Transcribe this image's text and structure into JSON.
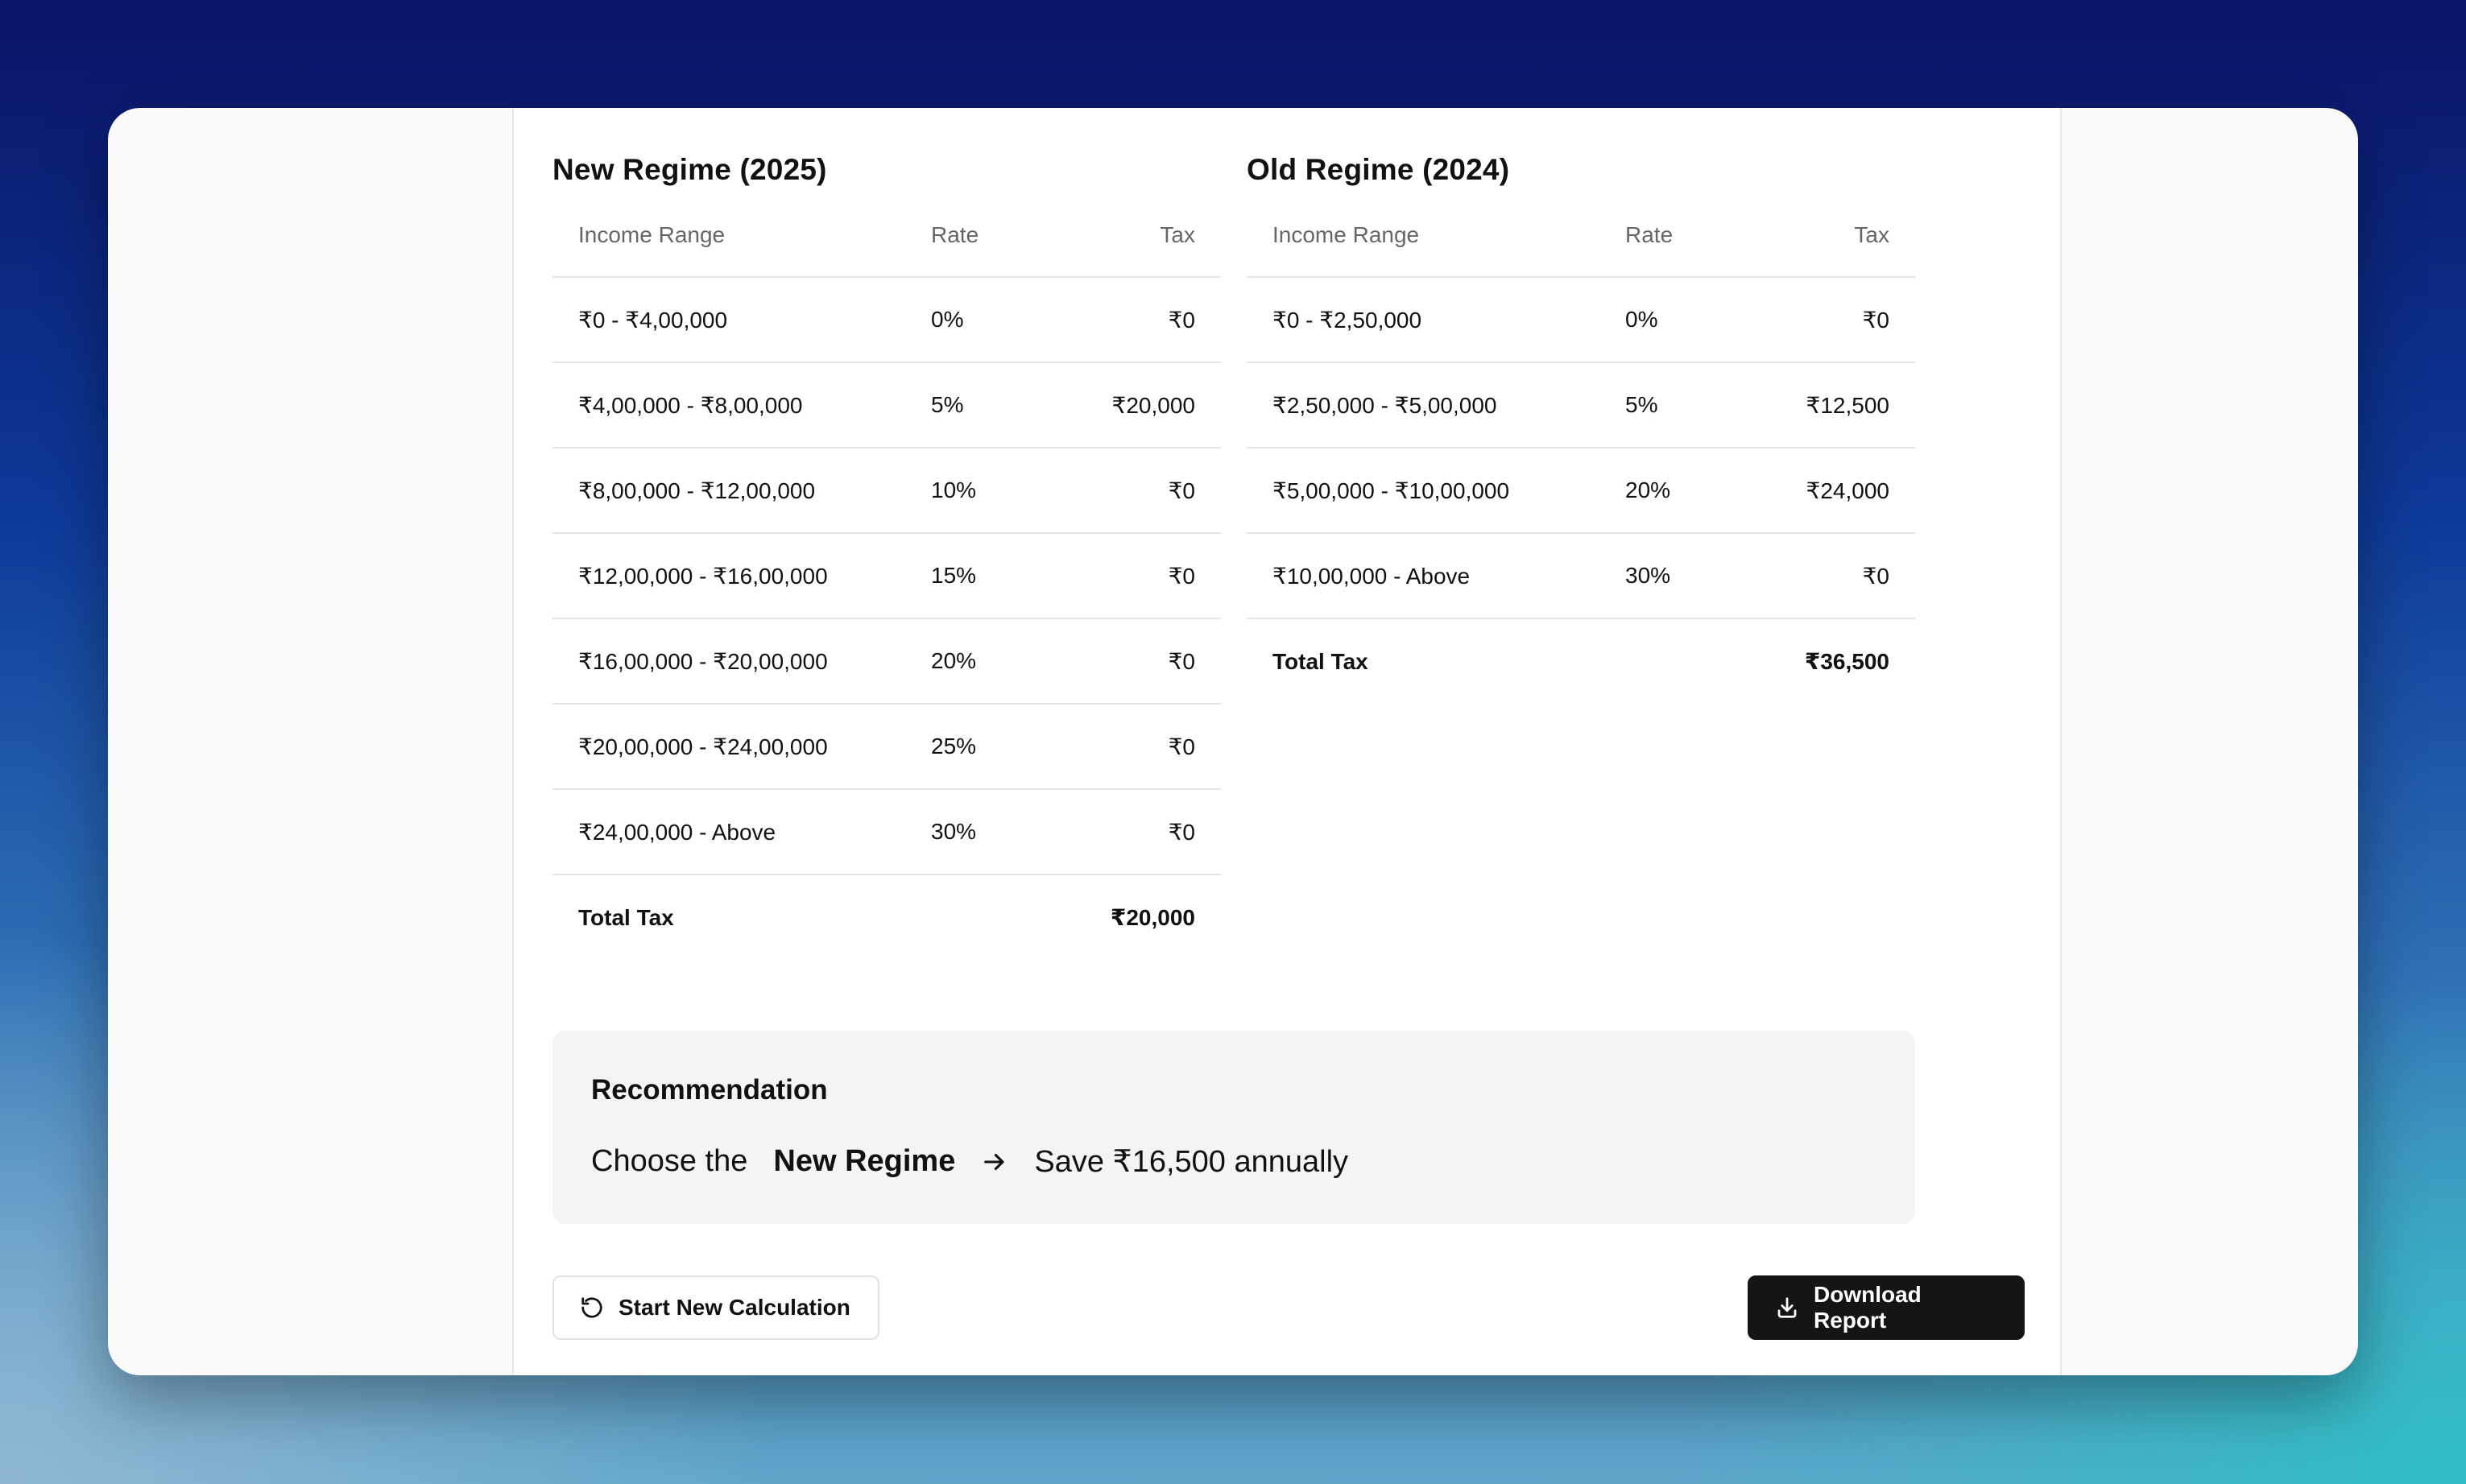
{
  "new_regime": {
    "title": "New Regime (2025)",
    "headers": {
      "range": "Income Range",
      "rate": "Rate",
      "tax": "Tax"
    },
    "rows": [
      {
        "range": "₹0 - ₹4,00,000",
        "rate": "0%",
        "tax": "₹0"
      },
      {
        "range": "₹4,00,000 - ₹8,00,000",
        "rate": "5%",
        "tax": "₹20,000"
      },
      {
        "range": "₹8,00,000 - ₹12,00,000",
        "rate": "10%",
        "tax": "₹0"
      },
      {
        "range": "₹12,00,000 - ₹16,00,000",
        "rate": "15%",
        "tax": "₹0"
      },
      {
        "range": "₹16,00,000 - ₹20,00,000",
        "rate": "20%",
        "tax": "₹0"
      },
      {
        "range": "₹20,00,000 - ₹24,00,000",
        "rate": "25%",
        "tax": "₹0"
      },
      {
        "range": "₹24,00,000 - Above",
        "rate": "30%",
        "tax": "₹0"
      }
    ],
    "total": {
      "label": "Total Tax",
      "value": "₹20,000"
    }
  },
  "old_regime": {
    "title": "Old Regime (2024)",
    "headers": {
      "range": "Income Range",
      "rate": "Rate",
      "tax": "Tax"
    },
    "rows": [
      {
        "range": "₹0 - ₹2,50,000",
        "rate": "0%",
        "tax": "₹0"
      },
      {
        "range": "₹2,50,000 - ₹5,00,000",
        "rate": "5%",
        "tax": "₹12,500"
      },
      {
        "range": "₹5,00,000 - ₹10,00,000",
        "rate": "20%",
        "tax": "₹24,000"
      },
      {
        "range": "₹10,00,000 - Above",
        "rate": "30%",
        "tax": "₹0"
      }
    ],
    "total": {
      "label": "Total Tax",
      "value": "₹36,500"
    }
  },
  "recommendation": {
    "title": "Recommendation",
    "prefix": "Choose the",
    "regime": "New Regime",
    "arrow_icon": "arrow-right-icon",
    "saving": "Save ₹16,500 annually"
  },
  "actions": {
    "restart_label": "Start New Calculation",
    "restart_icon": "refresh-icon",
    "download_label": "Download Report",
    "download_icon": "download-icon"
  }
}
